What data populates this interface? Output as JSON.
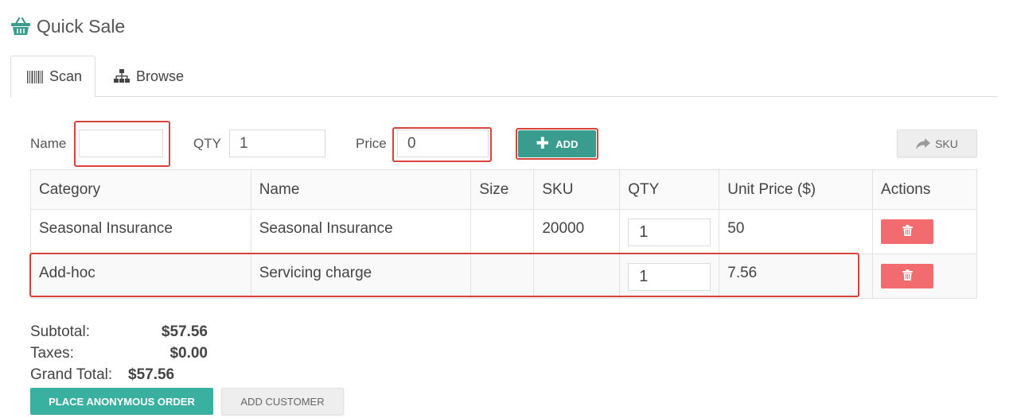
{
  "header": {
    "title": "Quick Sale",
    "icon": "basket-icon",
    "accent": "#3a9c8f"
  },
  "tabs": [
    {
      "label": "Scan",
      "icon": "barcode-icon",
      "active": true
    },
    {
      "label": "Browse",
      "icon": "sitemap-icon",
      "active": false
    }
  ],
  "form": {
    "name_label": "Name",
    "name_value": "",
    "qty_label": "QTY",
    "qty_value": "1",
    "price_label": "Price",
    "price_value": "0",
    "add_label": "ADD",
    "sku_label": "SKU"
  },
  "table": {
    "columns": [
      "Category",
      "Name",
      "Size",
      "SKU",
      "QTY",
      "Unit Price ($)",
      "Actions"
    ],
    "rows": [
      {
        "category": "Seasonal Insurance",
        "name": "Seasonal Insurance",
        "size": "",
        "sku": "20000",
        "qty": "1",
        "unit_price": "50"
      },
      {
        "category": "Add-hoc",
        "name": "Servicing charge",
        "size": "",
        "sku": "",
        "qty": "1",
        "unit_price": "7.56"
      }
    ]
  },
  "totals": {
    "subtotal_label": "Subtotal:",
    "subtotal_value": "$57.56",
    "taxes_label": "Taxes:",
    "taxes_value": "$0.00",
    "grand_label": "Grand Total:",
    "grand_value": "$57.56"
  },
  "actions": {
    "place_order": "PLACE ANONYMOUS ORDER",
    "add_customer": "ADD CUSTOMER"
  },
  "colors": {
    "primary": "#3a9c8f",
    "danger": "#f26b6f",
    "highlight": "#d9443a"
  }
}
